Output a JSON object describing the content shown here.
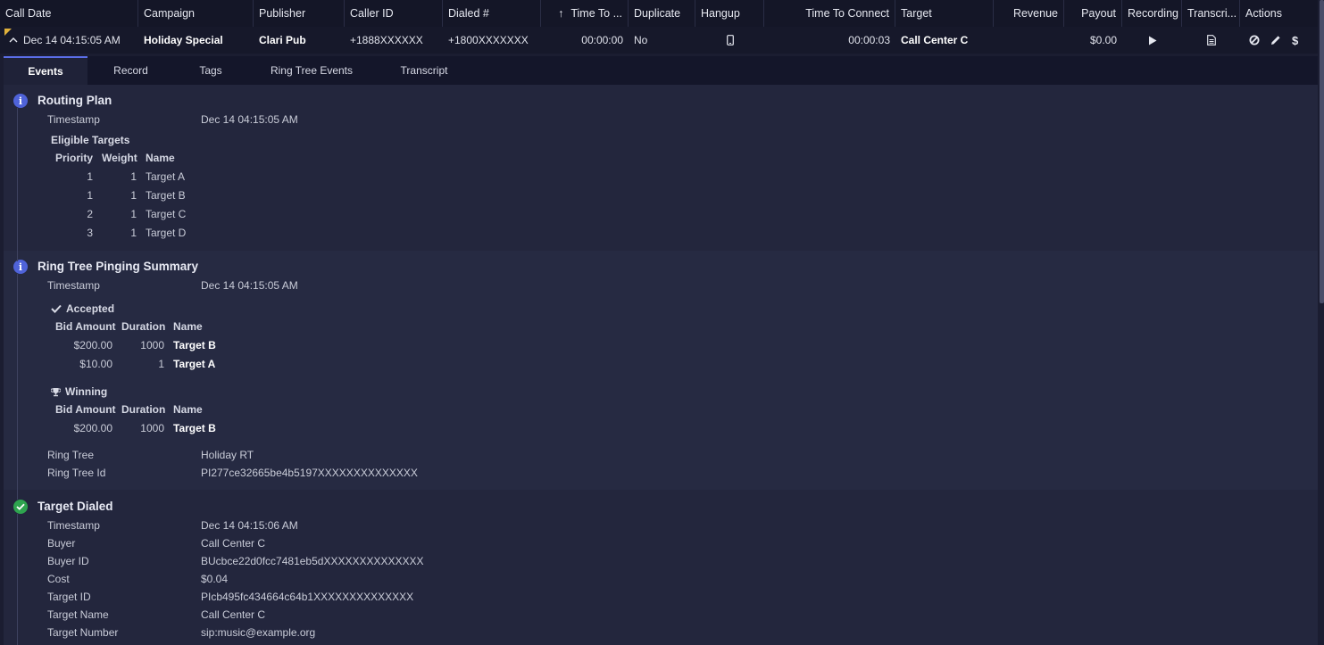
{
  "columns": [
    {
      "label": "Call Date",
      "w": 155
    },
    {
      "label": "Campaign",
      "w": 129
    },
    {
      "label": "Publisher",
      "w": 102
    },
    {
      "label": "Caller ID",
      "w": 110
    },
    {
      "label": "Dialed #",
      "w": 110
    },
    {
      "label": "Time To ...",
      "w": 98
    },
    {
      "label": "Duplicate",
      "w": 75
    },
    {
      "label": "Hangup",
      "w": 77
    },
    {
      "label": "Time To Connect",
      "w": 147
    },
    {
      "label": "Target",
      "w": 110
    },
    {
      "label": "Revenue",
      "w": 79
    },
    {
      "label": "Payout",
      "w": 65
    },
    {
      "label": "Recording",
      "w": 67
    },
    {
      "label": "Transcri...",
      "w": 65
    },
    {
      "label": "Actions",
      "w": 69
    }
  ],
  "sort_arrow": "↑",
  "row": {
    "call_date": "Dec 14 04:15:05 AM",
    "campaign": "Holiday Special",
    "publisher": "Clari Pub",
    "caller_id": "+1888XXXXXX",
    "dialed": "+1800XXXXXXX",
    "time_to": "00:00:00",
    "duplicate": "No",
    "hangup_icon": "phone-icon",
    "time_to_connect": "00:00:03",
    "target": "Call Center C",
    "revenue": "",
    "payout": "$0.00",
    "recording_icon": "play-icon",
    "transcript_icon": "document-icon",
    "actions": [
      "block-icon",
      "edit-icon",
      "dollar-icon"
    ],
    "dollar": "$"
  },
  "tabs": [
    {
      "label": "Events",
      "active": true
    },
    {
      "label": "Record"
    },
    {
      "label": "Tags"
    },
    {
      "label": "Ring Tree Events"
    },
    {
      "label": "Transcript"
    }
  ],
  "routing_plan": {
    "title": "Routing Plan",
    "timestamp_label": "Timestamp",
    "timestamp": "Dec 14 04:15:05 AM",
    "eligible_title": "Eligible Targets",
    "headers": [
      "Priority",
      "Weight",
      "Name"
    ],
    "rows": [
      {
        "priority": "1",
        "weight": "1",
        "name": "Target A"
      },
      {
        "priority": "1",
        "weight": "1",
        "name": "Target B"
      },
      {
        "priority": "2",
        "weight": "1",
        "name": "Target C"
      },
      {
        "priority": "3",
        "weight": "1",
        "name": "Target D"
      }
    ]
  },
  "ring_tree": {
    "title": "Ring Tree Pinging Summary",
    "timestamp_label": "Timestamp",
    "timestamp": "Dec 14 04:15:05 AM",
    "accepted_title": "Accepted",
    "winning_title": "Winning",
    "headers": [
      "Bid Amount",
      "Duration",
      "Name"
    ],
    "accepted": [
      {
        "bid": "$200.00",
        "duration": "1000",
        "name": "Target B"
      },
      {
        "bid": "$10.00",
        "duration": "1",
        "name": "Target A"
      }
    ],
    "winning": [
      {
        "bid": "$200.00",
        "duration": "1000",
        "name": "Target B"
      }
    ],
    "ring_tree_label": "Ring Tree",
    "ring_tree_value": "Holiday RT",
    "ring_tree_id_label": "Ring Tree Id",
    "ring_tree_id_value": "PI277ce32665be4b5197XXXXXXXXXXXXXX"
  },
  "target_dialed": {
    "title": "Target Dialed",
    "fields": [
      {
        "label": "Timestamp",
        "value": "Dec 14 04:15:06 AM"
      },
      {
        "label": "Buyer",
        "value": "Call Center C"
      },
      {
        "label": "Buyer ID",
        "value": "BUcbce22d0fcc7481eb5dXXXXXXXXXXXXXX"
      },
      {
        "label": "Cost",
        "value": "$0.04"
      },
      {
        "label": "Target ID",
        "value": "PIcb495fc434664c64b1XXXXXXXXXXXXXX"
      },
      {
        "label": "Target Name",
        "value": "Call Center C"
      },
      {
        "label": "Target Number",
        "value": "sip:music@example.org"
      }
    ]
  },
  "colors": {
    "accent": "#5b6ee8",
    "info": "#4f63d9",
    "success": "#2ea44f",
    "flag": "#e0b13b"
  }
}
